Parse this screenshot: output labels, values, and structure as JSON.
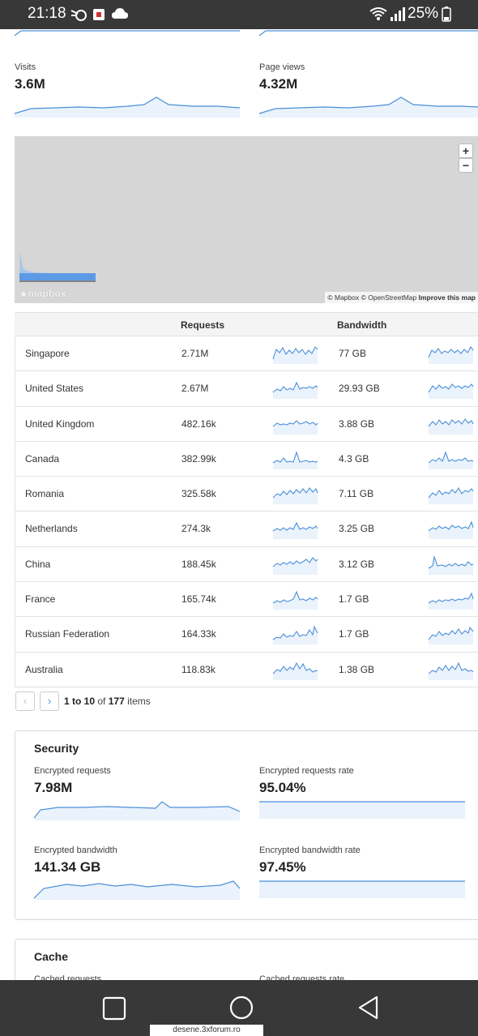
{
  "status_bar": {
    "time": "21:18",
    "battery": "25%"
  },
  "traffic": {
    "visits": {
      "label": "Visits",
      "value": "3.6M"
    },
    "page_views": {
      "label": "Page views",
      "value": "4.32M"
    }
  },
  "map": {
    "zoom_in": "+",
    "zoom_out": "−",
    "logo": "mapbox",
    "attribution": "© Mapbox © OpenStreetMap",
    "improve_link": "Improve this map"
  },
  "table": {
    "headers": {
      "requests": "Requests",
      "bandwidth": "Bandwidth"
    },
    "rows": [
      {
        "country": "Singapore",
        "requests": "2.71M",
        "bandwidth": "77 GB"
      },
      {
        "country": "United States",
        "requests": "2.67M",
        "bandwidth": "29.93 GB"
      },
      {
        "country": "United Kingdom",
        "requests": "482.16k",
        "bandwidth": "3.88 GB"
      },
      {
        "country": "Canada",
        "requests": "382.99k",
        "bandwidth": "4.3 GB"
      },
      {
        "country": "Romania",
        "requests": "325.58k",
        "bandwidth": "7.11 GB"
      },
      {
        "country": "Netherlands",
        "requests": "274.3k",
        "bandwidth": "3.25 GB"
      },
      {
        "country": "China",
        "requests": "188.45k",
        "bandwidth": "3.12 GB"
      },
      {
        "country": "France",
        "requests": "165.74k",
        "bandwidth": "1.7 GB"
      },
      {
        "country": "Russian Federation",
        "requests": "164.33k",
        "bandwidth": "1.7 GB"
      },
      {
        "country": "Australia",
        "requests": "118.83k",
        "bandwidth": "1.38 GB"
      }
    ]
  },
  "pagination": {
    "prev": "‹",
    "next": "›",
    "range": "1 to 10",
    "of": "of",
    "total": "177",
    "items": "items"
  },
  "security": {
    "title": "Security",
    "encrypted_requests": {
      "label": "Encrypted requests",
      "value": "7.98M"
    },
    "encrypted_requests_rate": {
      "label": "Encrypted requests rate",
      "value": "95.04%"
    },
    "encrypted_bandwidth": {
      "label": "Encrypted bandwidth",
      "value": "141.34 GB"
    },
    "encrypted_bandwidth_rate": {
      "label": "Encrypted bandwidth rate",
      "value": "97.45%"
    }
  },
  "cache": {
    "title": "Cache",
    "cached_requests": {
      "label": "Cached requests"
    },
    "cached_requests_rate": {
      "label": "Cached requests rate"
    }
  },
  "watermark": "desene.3xforum.ro",
  "colors": {
    "accent": "#4a90d9",
    "status_bar": "#383838"
  }
}
